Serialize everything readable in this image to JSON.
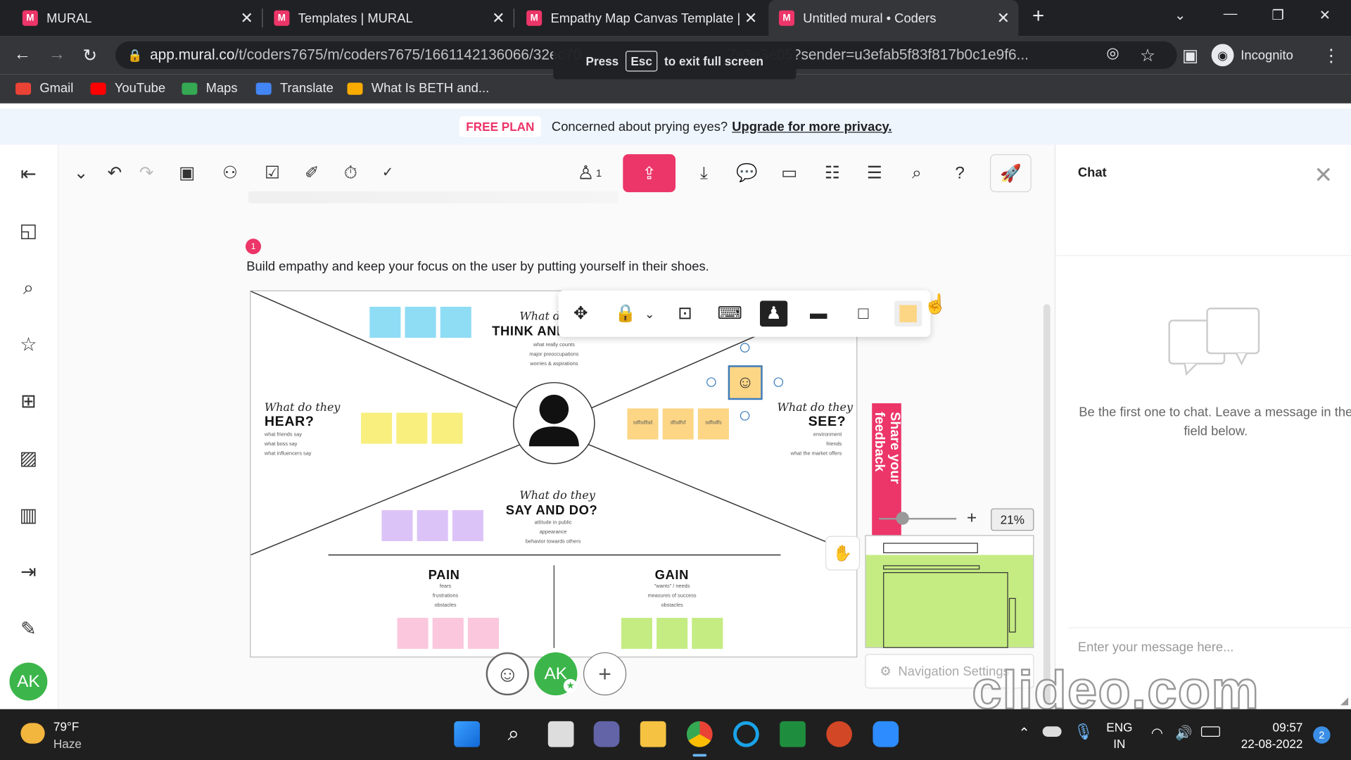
{
  "browser": {
    "tabs": [
      {
        "title": "MURAL"
      },
      {
        "title": "Templates | MURAL"
      },
      {
        "title": "Empathy Map Canvas Template |"
      },
      {
        "title": "Untitled mural • Coders"
      }
    ],
    "url_domain": "app.mural.co",
    "url_rest": "/t/coders7675/m/coders7675/1661142136066/32ec70",
    "url_tail": "7e3e3e05?sender=u3efab5f83f817b0c1e9f6...",
    "incognito_label": "Incognito",
    "bookmarks": [
      {
        "label": "Gmail"
      },
      {
        "label": "YouTube"
      },
      {
        "label": "Maps"
      },
      {
        "label": "Translate"
      },
      {
        "label": "What Is BETH and..."
      }
    ],
    "fullscreen_toast": {
      "press": "Press",
      "key": "Esc",
      "rest": "to exit full screen"
    }
  },
  "banner": {
    "badge": "FREE PLAN",
    "text": "Concerned about prying eyes?",
    "link": "Upgrade for more privacy."
  },
  "toolbar": {
    "members_count": "1"
  },
  "board": {
    "step": "1",
    "description": "Build empathy and keep your focus on the user by putting yourself in their shoes.",
    "think_script": "What do they",
    "think_heading": "THINK AND FEEL?",
    "think_sub": [
      "what really counts",
      "major preoccupations",
      "worries & aspirations"
    ],
    "hear_script": "What do they",
    "hear_heading": "HEAR?",
    "hear_sub": [
      "what friends say",
      "what boss say",
      "what influencers say"
    ],
    "see_script": "What do they",
    "see_heading": "SEE?",
    "see_sub": [
      "environment",
      "friends",
      "what the market offers"
    ],
    "say_script": "What do they",
    "say_heading": "SAY AND DO?",
    "say_sub": [
      "attitude in public",
      "appearance",
      "behavior towards others"
    ],
    "pain_heading": "PAIN",
    "pain_sub": [
      "fears",
      "frustrations",
      "obstacles"
    ],
    "gain_heading": "GAIN",
    "gain_sub": [
      "\"wants\" / needs",
      "measures of success",
      "obstacles"
    ],
    "see_sticky_text": [
      "sdfsdfsd",
      "dfsdfsf",
      "sdfsdfs"
    ]
  },
  "feedback_tab": "Share your feedback",
  "zoom_level": "21%",
  "nav_settings": "Navigation Settings",
  "user_initials": "AK",
  "chat": {
    "title": "Chat",
    "empty_text": "Be the first one to chat. Leave a message in the field below.",
    "input_placeholder": "Enter your message here..."
  },
  "taskbar": {
    "weather_temp": "79°F",
    "weather_desc": "Haze",
    "lang": "ENG",
    "region": "IN",
    "time": "09:57",
    "date": "22-08-2022",
    "notif_count": "2"
  },
  "watermark": "clideo.com",
  "colors": {
    "mural_pink": "#ec3568",
    "sticky_blue": "#8fdcf5",
    "sticky_yellow": "#f8ef7e",
    "sticky_orange": "#fcd685",
    "sticky_purple": "#dcc3f7",
    "sticky_pink": "#fbc7dd",
    "sticky_green": "#c5ec83"
  }
}
